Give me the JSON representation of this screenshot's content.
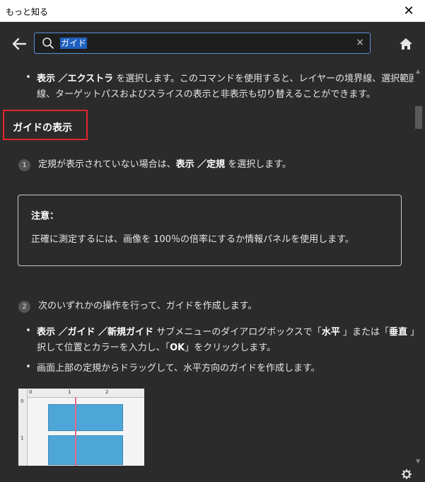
{
  "window": {
    "title": "もっと知る",
    "close": "✕"
  },
  "search": {
    "query": "ガイド",
    "clear": "×"
  },
  "icons": {
    "back": "back-arrow-icon",
    "search": "search-icon",
    "home": "home-icon",
    "gear": "gear-icon"
  },
  "colors": {
    "background": "#2b2b2b",
    "search_border": "#5b8fd7",
    "highlight_box": "#e0262c",
    "guide_line": "#e36a8f",
    "window_pane": "#4ea6d8"
  },
  "content": {
    "intro": {
      "bullet": "•",
      "part1_bold": "表示 ／エクストラ",
      "part1_rest": " を選択します。このコマンドを使用すると、レイヤーの境界線、選択範囲の境界",
      "line2": "線、ターゲットパスおよびスライスの表示と非表示も切り替えることができます。"
    },
    "section_title": "ガイドの表示",
    "step1": {
      "num": "1",
      "text_a": "定規が表示されていない場合は、",
      "bold_a": "表示 ／定規",
      "text_b": " を選択します。"
    },
    "note": {
      "title": "注意：",
      "body": "正確に測定するには、画像を 100％の倍率にするか情報パネルを使用します。"
    },
    "step2": {
      "num": "2",
      "text": "次のいずれかの操作を行って、ガイドを作成します。"
    },
    "bullet_a": {
      "bullet": "•",
      "bold_1": "表示 ／ガイド ／新規ガイド",
      "text_1": " サブメニューのダイアログボックスで「",
      "bold_2": "水平",
      "text_2": " 」または「",
      "bold_3": "垂直",
      "text_3": " 」方向を選",
      "line2_a": "択して位置とカラーを入力し、「",
      "line2_bold": "OK",
      "line2_b": "」をクリックします。"
    },
    "bullet_b": {
      "bullet": "•",
      "text": "画面上部の定規からドラッグして、水平方向のガイドを作成します。"
    },
    "illustration": {
      "ruler_top": [
        "0",
        "1",
        "2"
      ],
      "ruler_left": [
        "0",
        "1"
      ]
    }
  }
}
